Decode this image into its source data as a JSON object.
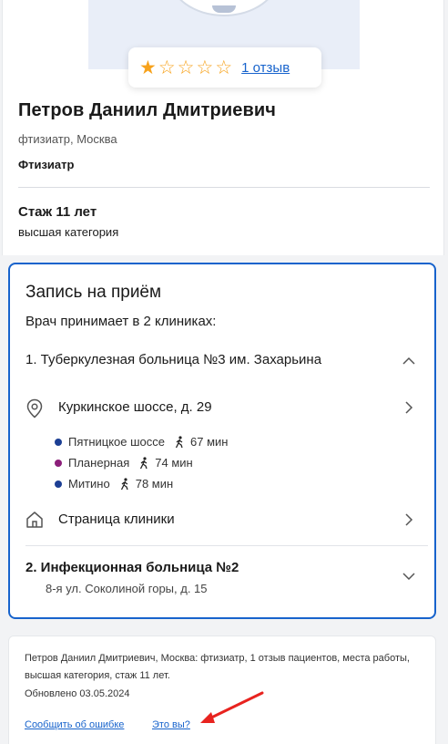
{
  "rating": {
    "stars_filled": 1,
    "stars_total": 5,
    "reviews_link": "1 отзыв"
  },
  "doctor": {
    "name": "Петров Даниил Дмитриевич",
    "specialty_city": "фтизиатр, Москва",
    "specialty": "Фтизиатр",
    "experience": "Стаж 11 лет",
    "category": "высшая категория"
  },
  "appointment": {
    "title": "Запись на приём",
    "subtitle": "Врач принимает в 2 клиниках:",
    "clinics": [
      {
        "label": "1.  Туберкулезная больница №3 им. Захарьина",
        "address": "Куркинское шоссе, д. 29",
        "metro": [
          {
            "station": "Пятницкое шоссе",
            "time": "67 мин",
            "color": "#1c3f94"
          },
          {
            "station": "Планерная",
            "time": "74 мин",
            "color": "#8c1f7a"
          },
          {
            "station": "Митино",
            "time": "78 мин",
            "color": "#1c3f94"
          }
        ],
        "clinic_page": "Страница клиники"
      },
      {
        "label": "2.  Инфекционная больница №2",
        "address": "8-я ул. Соколиной горы, д. 15"
      }
    ]
  },
  "info": {
    "summary": "Петров Даниил Дмитриевич, Москва: фтизиатр, 1 отзыв пациентов, места работы, высшая категория, стаж 11 лет.",
    "updated": "Обновлено 03.05.2024",
    "report_error": "Сообщить об ошибке",
    "is_it_you": "Это вы?"
  },
  "colors": {
    "accent": "#1763cc",
    "star": "#f7a21b",
    "arrow": "#e8231f"
  }
}
